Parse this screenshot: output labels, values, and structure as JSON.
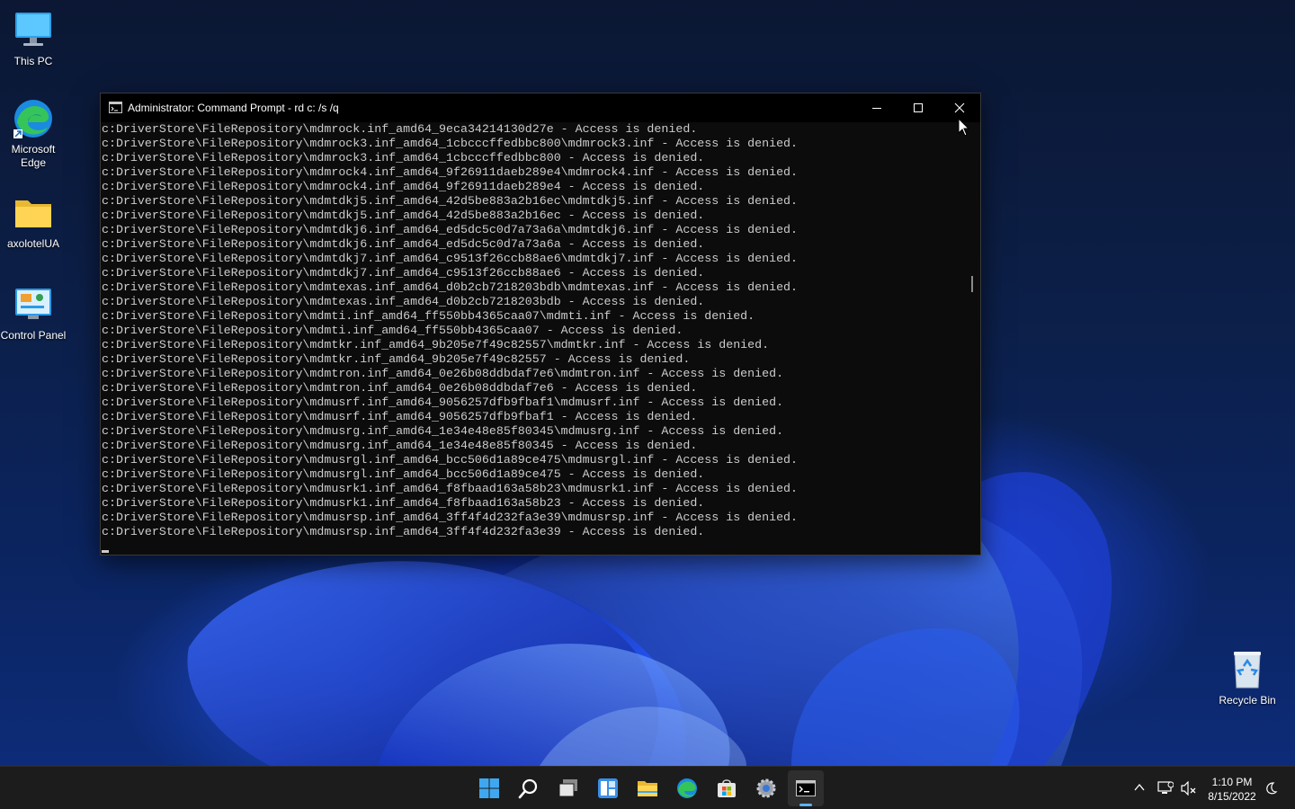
{
  "desktop": {
    "icons": [
      {
        "label": "This PC"
      },
      {
        "label": "Microsoft Edge"
      },
      {
        "label": "axolotelUA"
      },
      {
        "label": "Control Panel"
      },
      {
        "label": "Recycle Bin"
      }
    ]
  },
  "window": {
    "title": "Administrator: Command Prompt - rd  c: /s /q",
    "console_lines": [
      "c:DriverStore\\FileRepository\\mdmrock.inf_amd64_9eca34214130d27e - Access is denied.",
      "c:DriverStore\\FileRepository\\mdmrock3.inf_amd64_1cbcccffedbbc800\\mdmrock3.inf - Access is denied.",
      "c:DriverStore\\FileRepository\\mdmrock3.inf_amd64_1cbcccffedbbc800 - Access is denied.",
      "c:DriverStore\\FileRepository\\mdmrock4.inf_amd64_9f26911daeb289e4\\mdmrock4.inf - Access is denied.",
      "c:DriverStore\\FileRepository\\mdmrock4.inf_amd64_9f26911daeb289e4 - Access is denied.",
      "c:DriverStore\\FileRepository\\mdmtdkj5.inf_amd64_42d5be883a2b16ec\\mdmtdkj5.inf - Access is denied.",
      "c:DriverStore\\FileRepository\\mdmtdkj5.inf_amd64_42d5be883a2b16ec - Access is denied.",
      "c:DriverStore\\FileRepository\\mdmtdkj6.inf_amd64_ed5dc5c0d7a73a6a\\mdmtdkj6.inf - Access is denied.",
      "c:DriverStore\\FileRepository\\mdmtdkj6.inf_amd64_ed5dc5c0d7a73a6a - Access is denied.",
      "c:DriverStore\\FileRepository\\mdmtdkj7.inf_amd64_c9513f26ccb88ae6\\mdmtdkj7.inf - Access is denied.",
      "c:DriverStore\\FileRepository\\mdmtdkj7.inf_amd64_c9513f26ccb88ae6 - Access is denied.",
      "c:DriverStore\\FileRepository\\mdmtexas.inf_amd64_d0b2cb7218203bdb\\mdmtexas.inf - Access is denied.",
      "c:DriverStore\\FileRepository\\mdmtexas.inf_amd64_d0b2cb7218203bdb - Access is denied.",
      "c:DriverStore\\FileRepository\\mdmti.inf_amd64_ff550bb4365caa07\\mdmti.inf - Access is denied.",
      "c:DriverStore\\FileRepository\\mdmti.inf_amd64_ff550bb4365caa07 - Access is denied.",
      "c:DriverStore\\FileRepository\\mdmtkr.inf_amd64_9b205e7f49c82557\\mdmtkr.inf - Access is denied.",
      "c:DriverStore\\FileRepository\\mdmtkr.inf_amd64_9b205e7f49c82557 - Access is denied.",
      "c:DriverStore\\FileRepository\\mdmtron.inf_amd64_0e26b08ddbdaf7e6\\mdmtron.inf - Access is denied.",
      "c:DriverStore\\FileRepository\\mdmtron.inf_amd64_0e26b08ddbdaf7e6 - Access is denied.",
      "c:DriverStore\\FileRepository\\mdmusrf.inf_amd64_9056257dfb9fbaf1\\mdmusrf.inf - Access is denied.",
      "c:DriverStore\\FileRepository\\mdmusrf.inf_amd64_9056257dfb9fbaf1 - Access is denied.",
      "c:DriverStore\\FileRepository\\mdmusrg.inf_amd64_1e34e48e85f80345\\mdmusrg.inf - Access is denied.",
      "c:DriverStore\\FileRepository\\mdmusrg.inf_amd64_1e34e48e85f80345 - Access is denied.",
      "c:DriverStore\\FileRepository\\mdmusrgl.inf_amd64_bcc506d1a89ce475\\mdmusrgl.inf - Access is denied.",
      "c:DriverStore\\FileRepository\\mdmusrgl.inf_amd64_bcc506d1a89ce475 - Access is denied.",
      "c:DriverStore\\FileRepository\\mdmusrk1.inf_amd64_f8fbaad163a58b23\\mdmusrk1.inf - Access is denied.",
      "c:DriverStore\\FileRepository\\mdmusrk1.inf_amd64_f8fbaad163a58b23 - Access is denied.",
      "c:DriverStore\\FileRepository\\mdmusrsp.inf_amd64_3ff4f4d232fa3e39\\mdmusrsp.inf - Access is denied.",
      "c:DriverStore\\FileRepository\\mdmusrsp.inf_amd64_3ff4f4d232fa3e39 - Access is denied."
    ],
    "colors": {
      "background": "#0c0c0c",
      "text": "#cccccc",
      "titlebar": "#000000"
    }
  },
  "taskbar": {
    "items": [
      {
        "icon": "windows-start-icon"
      },
      {
        "icon": "search-icon"
      },
      {
        "icon": "task-view-icon"
      },
      {
        "icon": "widgets-icon"
      },
      {
        "icon": "file-explorer-icon"
      },
      {
        "icon": "edge-icon"
      },
      {
        "icon": "store-icon"
      },
      {
        "icon": "settings-icon"
      },
      {
        "icon": "command-prompt-icon",
        "active": true
      }
    ],
    "tray": {
      "time": "1:10 PM",
      "date": "8/15/2022"
    },
    "accent": "#5fb2f2"
  }
}
